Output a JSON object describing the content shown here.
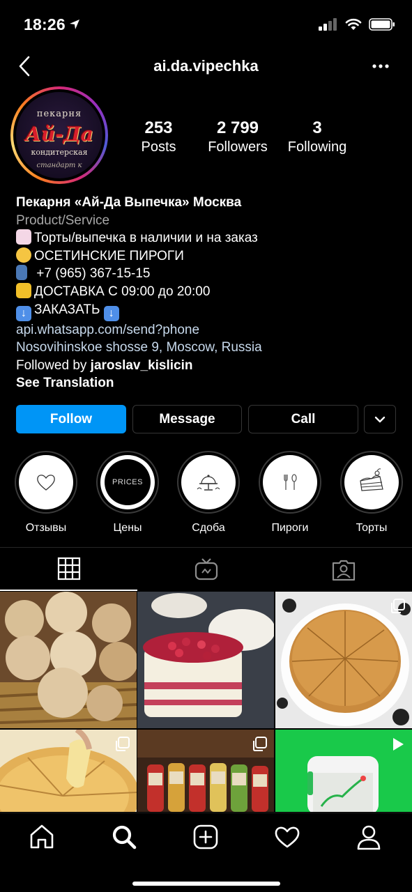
{
  "status": {
    "time": "18:26"
  },
  "nav": {
    "title": "ai.da.vipechka"
  },
  "avatar": {
    "logo_top": "пекарня",
    "logo_main": "Ай-Да",
    "logo_sub": "кондитерская",
    "logo_bottom": "стандарт к"
  },
  "stats": [
    {
      "num": "253",
      "label": "Posts"
    },
    {
      "num": "2 799",
      "label": "Followers"
    },
    {
      "num": "3",
      "label": "Following"
    }
  ],
  "bio": {
    "name": "Пекарня «Ай-Да Выпечка» Москва",
    "category": "Product/Service",
    "lines": [
      "Торты/выпечка в наличии и на заказ",
      "ОСЕТИНСКИЕ ПИРОГИ",
      " +7 (965) 367-15-15",
      "ДОСТАВКА С 09:00 до 20:00",
      "ЗАКАЗАТЬ "
    ],
    "link": "api.whatsapp.com/send?phone",
    "address": "Nosovihinskoe shosse 9, Moscow, Russia",
    "followed_by_prefix": "Followed by ",
    "followed_by_user": "jaroslav_kislicin",
    "see_translation": "See Translation"
  },
  "buttons": {
    "follow": "Follow",
    "message": "Message",
    "call": "Call"
  },
  "highlights": [
    {
      "label": "Отзывы",
      "icon": "heart-outline-icon"
    },
    {
      "label": "Цены",
      "icon": "prices-badge",
      "text": "PRICES"
    },
    {
      "label": "Сдоба",
      "icon": "cake-stand-icon"
    },
    {
      "label": "Пироги",
      "icon": "cutlery-icon"
    },
    {
      "label": "Торты",
      "icon": "cake-slice-icon"
    }
  ],
  "tabs": [
    "grid-icon",
    "igtv-icon",
    "tagged-icon"
  ],
  "colors": {
    "follow": "#0095f6",
    "background": "#000000",
    "secondary_text": "#a8a8a8"
  }
}
